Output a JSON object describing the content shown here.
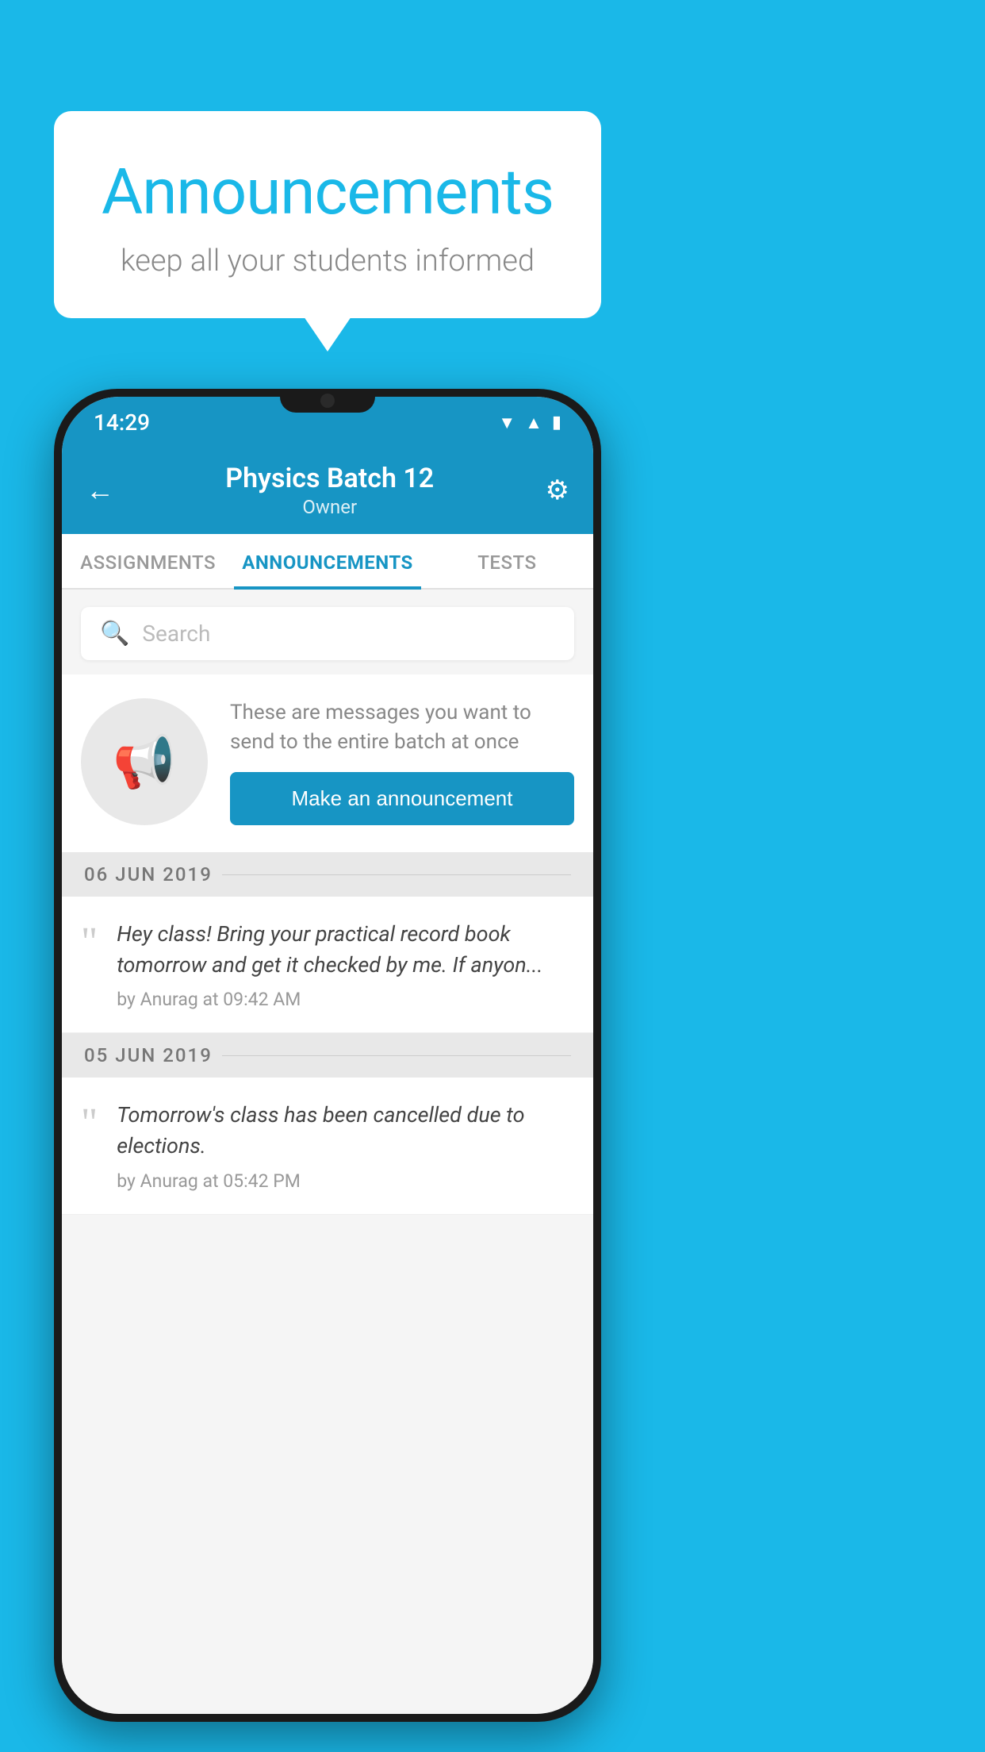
{
  "background_color": "#1ab8e8",
  "speech_bubble": {
    "title": "Announcements",
    "subtitle": "keep all your students informed"
  },
  "phone": {
    "status_bar": {
      "time": "14:29",
      "icons": [
        "wifi",
        "signal",
        "battery"
      ]
    },
    "header": {
      "back_label": "←",
      "title": "Physics Batch 12",
      "subtitle": "Owner",
      "settings_label": "⚙"
    },
    "tabs": [
      {
        "label": "ASSIGNMENTS",
        "active": false
      },
      {
        "label": "ANNOUNCEMENTS",
        "active": true
      },
      {
        "label": "TESTS",
        "active": false
      },
      {
        "label": "...",
        "active": false
      }
    ],
    "search": {
      "placeholder": "Search"
    },
    "promo_card": {
      "text": "These are messages you want to send to the entire batch at once",
      "button_label": "Make an announcement"
    },
    "announcements": [
      {
        "date": "06  JUN  2019",
        "message": "Hey class! Bring your practical record book tomorrow and get it checked by me. If anyon...",
        "meta": "by Anurag at 09:42 AM"
      },
      {
        "date": "05  JUN  2019",
        "message": "Tomorrow's class has been cancelled due to elections.",
        "meta": "by Anurag at 05:42 PM"
      }
    ]
  }
}
